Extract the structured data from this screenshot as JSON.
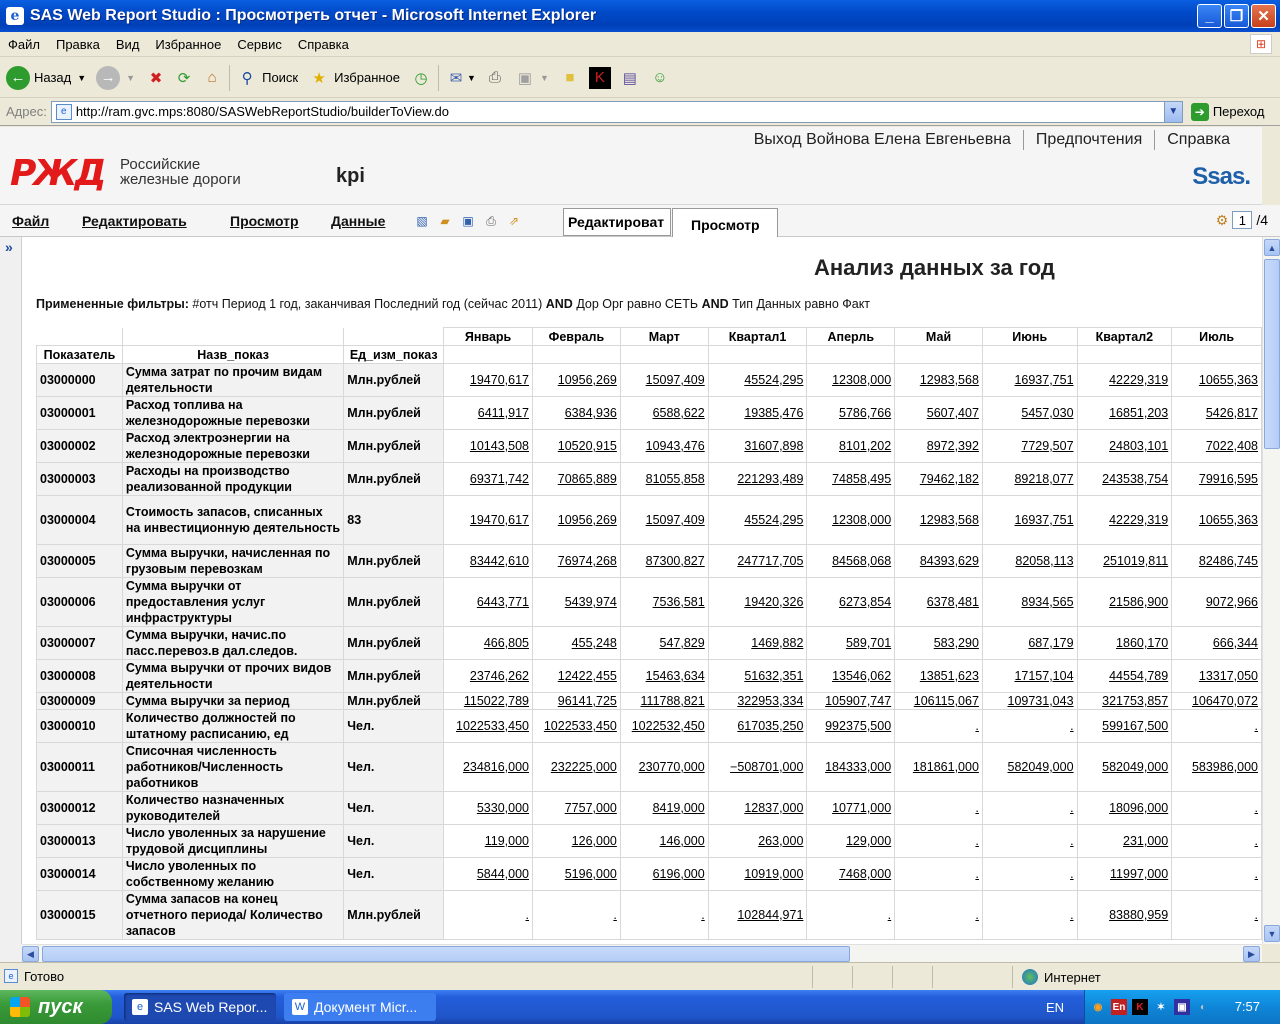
{
  "window": {
    "title": "SAS Web Report Studio : Просмотреть отчет - Microsoft Internet Explorer"
  },
  "ie_menu": [
    "Файл",
    "Правка",
    "Вид",
    "Избранное",
    "Сервис",
    "Справка"
  ],
  "ie_toolbar": {
    "back": "Назад",
    "search": "Поиск",
    "favorites": "Избранное"
  },
  "address": {
    "label": "Адрес:",
    "url": "http://ram.gvc.mps:8080/SASWebReportStudio/builderToView.do",
    "go": "Переход"
  },
  "sas_header": {
    "logout": "Выход Войнова Елена Евгеньевна",
    "preferences": "Предпочтения",
    "help": "Справка",
    "company_line1": "Российские",
    "company_line2": "железные дороги",
    "report_name": "kpi",
    "logo_text": "РЖД",
    "sas_logo": "Ssas."
  },
  "app_menu": {
    "file": "Файл",
    "edit": "Редактировать",
    "view": "Просмотр",
    "data": "Данные",
    "tab_edit": "Редактироват",
    "tab_view": "Просмотр",
    "page_current": "1",
    "page_total": "/4"
  },
  "report": {
    "title": "Анализ данных за год",
    "filters_label": "Примененные фильтры:",
    "filters_text1": " #отч Период 1 год, заканчивая Последний год (сейчас 2011) ",
    "and1": "AND",
    "filters_text2": " Дор Орг равно СЕТЬ ",
    "and2": "AND",
    "filters_text3": " Тип Данных равно Факт"
  },
  "table": {
    "columns": [
      "Показатель",
      "Назв_показ",
      "Ед_изм_показ"
    ],
    "months": [
      "Январь",
      "Февраль",
      "Март",
      "Квартал1",
      "Аперль",
      "Май",
      "Июнь",
      "Квартал2",
      "Июль"
    ],
    "rows": [
      {
        "code": "03000000",
        "name": "Сумма затрат по прочим видам деятельности",
        "unit": "Млн.рублей",
        "values": [
          "19470,617",
          "10956,269",
          "15097,409",
          "45524,295",
          "12308,000",
          "12983,568",
          "16937,751",
          "42229,319",
          "10655,363"
        ]
      },
      {
        "code": "03000001",
        "name": "Расход топлива на железнодорожные перевозки",
        "unit": "Млн.рублей",
        "values": [
          "6411,917",
          "6384,936",
          "6588,622",
          "19385,476",
          "5786,766",
          "5607,407",
          "5457,030",
          "16851,203",
          "5426,817"
        ]
      },
      {
        "code": "03000002",
        "name": "Расход электроэнергии на железнодорожные перевозки",
        "unit": "Млн.рублей",
        "values": [
          "10143,508",
          "10520,915",
          "10943,476",
          "31607,898",
          "8101,202",
          "8972,392",
          "7729,507",
          "24803,101",
          "7022,408"
        ]
      },
      {
        "code": "03000003",
        "name": "Расходы на производство реализованной продукции",
        "unit": "Млн.рублей",
        "values": [
          "69371,742",
          "70865,889",
          "81055,858",
          "221293,489",
          "74858,495",
          "79462,182",
          "89218,077",
          "243538,754",
          "79916,595"
        ]
      },
      {
        "code": "03000004",
        "name": "Стоимость запасов, списанных на инвестиционную деятельность",
        "unit": "83",
        "values": [
          "19470,617",
          "10956,269",
          "15097,409",
          "45524,295",
          "12308,000",
          "12983,568",
          "16937,751",
          "42229,319",
          "10655,363"
        ]
      },
      {
        "code": "03000005",
        "name": "Сумма выручки, начисленная по грузовым перевозкам",
        "unit": "Млн.рублей",
        "values": [
          "83442,610",
          "76974,268",
          "87300,827",
          "247717,705",
          "84568,068",
          "84393,629",
          "82058,113",
          "251019,811",
          "82486,745"
        ]
      },
      {
        "code": "03000006",
        "name": "Сумма выручки от предоставления услуг инфраструктуры",
        "unit": "Млн.рублей",
        "values": [
          "6443,771",
          "5439,974",
          "7536,581",
          "19420,326",
          "6273,854",
          "6378,481",
          "8934,565",
          "21586,900",
          "9072,966"
        ]
      },
      {
        "code": "03000007",
        "name": "Сумма выручки, начис.по пасс.перевоз.в дал.следов.",
        "unit": "Млн.рублей",
        "values": [
          "466,805",
          "455,248",
          "547,829",
          "1469,882",
          "589,701",
          "583,290",
          "687,179",
          "1860,170",
          "666,344"
        ]
      },
      {
        "code": "03000008",
        "name": "Сумма выручки от прочих видов деятельности",
        "unit": "Млн.рублей",
        "values": [
          "23746,262",
          "12422,455",
          "15463,634",
          "51632,351",
          "13546,062",
          "13851,623",
          "17157,104",
          "44554,789",
          "13317,050"
        ]
      },
      {
        "code": "03000009",
        "name": "Сумма выручки за период",
        "unit": "Млн.рублей",
        "values": [
          "115022,789",
          "96141,725",
          "111788,821",
          "322953,334",
          "105907,747",
          "106115,067",
          "109731,043",
          "321753,857",
          "106470,072"
        ]
      },
      {
        "code": "03000010",
        "name": "Количество должностей по штатному расписанию, ед",
        "unit": "Чел.",
        "values": [
          "1022533,450",
          "1022533,450",
          "1022532,450",
          "617035,250",
          "992375,500",
          ".",
          ".",
          "599167,500",
          "."
        ]
      },
      {
        "code": "03000011",
        "name": "Списочная численность работников/Численность работников",
        "unit": "Чел.",
        "values": [
          "234816,000",
          "232225,000",
          "230770,000",
          "−508701,000",
          "184333,000",
          "181861,000",
          "582049,000",
          "582049,000",
          "583986,000"
        ]
      },
      {
        "code": "03000012",
        "name": "Количество назначенных руководителей",
        "unit": "Чел.",
        "values": [
          "5330,000",
          "7757,000",
          "8419,000",
          "12837,000",
          "10771,000",
          ".",
          ".",
          "18096,000",
          "."
        ]
      },
      {
        "code": "03000013",
        "name": "Число уволенных за нарушение трудовой дисциплины",
        "unit": "Чел.",
        "values": [
          "119,000",
          "126,000",
          "146,000",
          "263,000",
          "129,000",
          ".",
          ".",
          "231,000",
          "."
        ]
      },
      {
        "code": "03000014",
        "name": "Число уволенных по собственному желанию",
        "unit": "Чел.",
        "values": [
          "5844,000",
          "5196,000",
          "6196,000",
          "10919,000",
          "7468,000",
          ".",
          ".",
          "11997,000",
          "."
        ]
      },
      {
        "code": "03000015",
        "name": "Сумма запасов на конец отчетного периода/ Количество запасов",
        "unit": "Млн.рублей",
        "values": [
          ".",
          ".",
          ".",
          "102844,971",
          ".",
          ".",
          ".",
          "83880,959",
          "."
        ]
      }
    ]
  },
  "status": {
    "text": "Готово",
    "zone": "Интернет"
  },
  "taskbar": {
    "start": "пуск",
    "task1": "SAS Web Repor...",
    "task2": "Документ Micr...",
    "lang": "EN",
    "time": "7:57"
  }
}
